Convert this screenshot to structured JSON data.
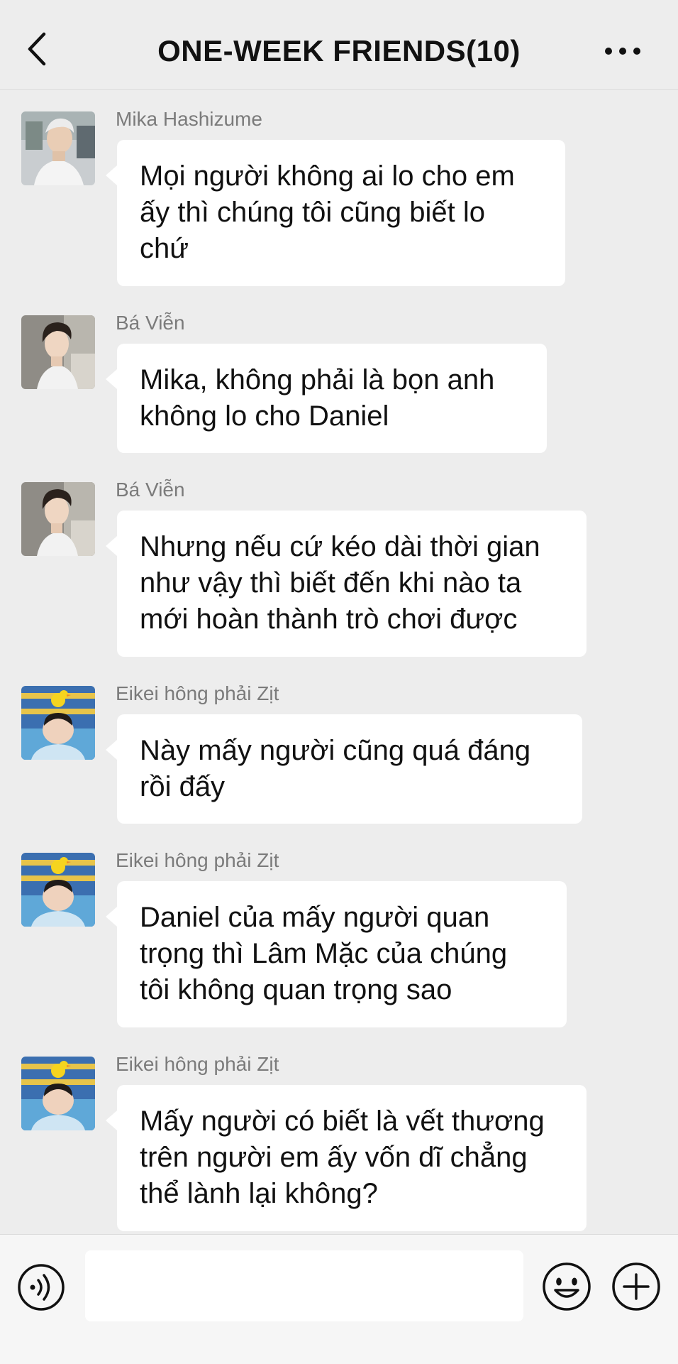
{
  "header": {
    "title": "ONE-WEEK FRIENDS(10)",
    "back_icon": "chevron-left-icon",
    "more_icon": "more-horizontal-icon"
  },
  "messages": [
    {
      "sender": "Mika Hashizume",
      "avatar": "avatar-mika",
      "lines": [
        "Mọi người không ai lo cho em",
        "ấy thì chúng tôi cũng biết lo",
        "chứ"
      ]
    },
    {
      "sender": "Bá Viễn",
      "avatar": "avatar-ba-vien",
      "lines": [
        "Mika, không phải là bọn anh",
        "không lo cho Daniel"
      ]
    },
    {
      "sender": "Bá Viễn",
      "avatar": "avatar-ba-vien",
      "lines": [
        "Nhưng nếu cứ kéo dài thời gian",
        "như vậy thì biết đến khi nào ta",
        "mới hoàn thành trò chơi được"
      ]
    },
    {
      "sender": "Eikei hông phải Zịt",
      "avatar": "avatar-eikei",
      "lines": [
        "Này mấy người cũng quá đáng",
        "rồi đấy"
      ]
    },
    {
      "sender": "Eikei hông phải Zịt",
      "avatar": "avatar-eikei",
      "lines": [
        "Daniel của mấy người quan",
        "trọng thì Lâm Mặc của chúng",
        "tôi không quan trọng sao"
      ]
    },
    {
      "sender": "Eikei hông phải Zịt",
      "avatar": "avatar-eikei",
      "lines": [
        "Mấy người có biết là vết thương",
        "trên người em ấy vốn dĩ chẳng",
        "thể lành lại không?"
      ]
    }
  ],
  "input_bar": {
    "voice_icon": "voice-icon",
    "text_value": "",
    "emoji_icon": "emoji-icon",
    "plus_icon": "plus-icon"
  },
  "colors": {
    "background": "#ededed",
    "bubble": "#ffffff",
    "sender_text": "#7b7b7b",
    "text": "#111111"
  }
}
